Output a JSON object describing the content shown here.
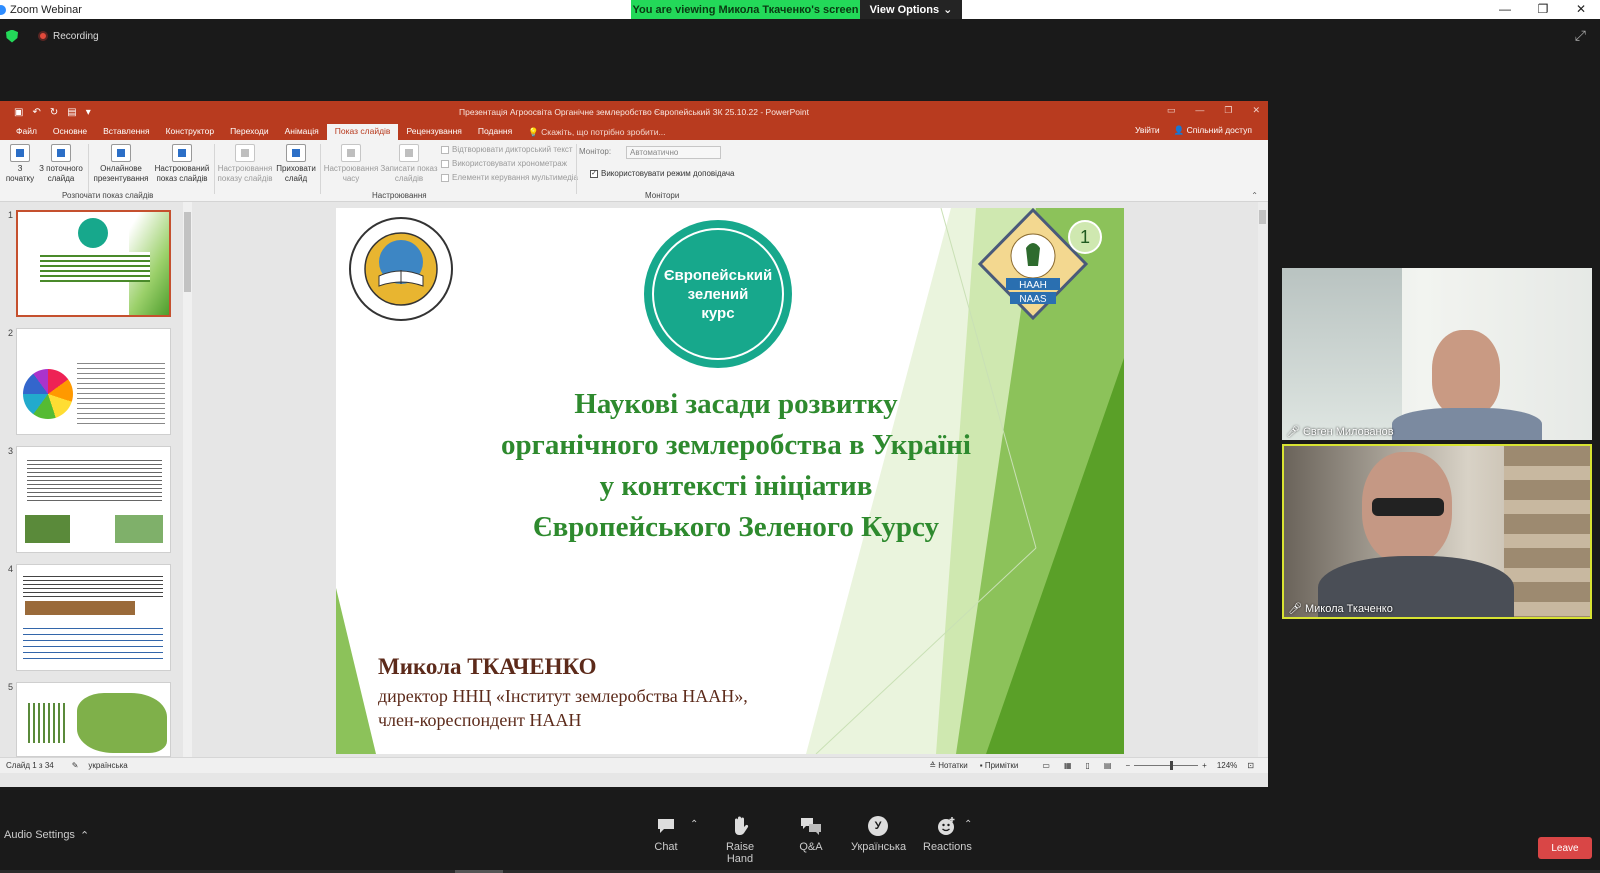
{
  "window": {
    "title": "Zoom Webinar",
    "viewing_banner": "You are viewing Микола Ткаченко's screen",
    "view_options": "View Options",
    "recording": "Recording"
  },
  "ppt": {
    "title": "Презентація Агроосвіта Органічне землеробство Європейський ЗК 25.10.22 - PowerPoint",
    "tabs": [
      "Файл",
      "Основне",
      "Вставлення",
      "Конструктор",
      "Переходи",
      "Анімація",
      "Показ слайдів",
      "Рецензування",
      "Подання"
    ],
    "tell_me": "Скажіть, що потрібно зробити...",
    "signin": "Увійти",
    "share": "Спільний доступ",
    "ribbon": {
      "from_begin": [
        "З",
        "початку"
      ],
      "from_current": [
        "З поточного",
        "слайда"
      ],
      "online": [
        "Онлайнове",
        "презентування"
      ],
      "custom": [
        "Настроюваний",
        "показ слайдів"
      ],
      "setup": [
        "Настроювання",
        "показу слайдів"
      ],
      "hide": [
        "Приховати",
        "слайд"
      ],
      "rehearse": [
        "Настроювання",
        "часу"
      ],
      "record": [
        "Записати показ",
        "слайдів"
      ],
      "play_narr": "Відтворювати дикторський текст",
      "use_timings": "Використовувати хронометраж",
      "show_media": "Елементи керування мультимедіа",
      "monitor_label": "Монітор:",
      "monitor_value": "Автоматично",
      "presenter_view": "Використовувати режим доповідача",
      "group_start": "Розпочати показ слайдів",
      "group_setup": "Настроювання",
      "group_monitors": "Монітори"
    },
    "status": {
      "slide_of": "Слайд 1 з 34",
      "lang": "українська",
      "notes": "Нотатки",
      "comments": "Примітки",
      "zoom": "124%"
    },
    "thumb_nums": [
      "1",
      "2",
      "3",
      "4",
      "5"
    ]
  },
  "slide": {
    "badge": [
      "Європейський",
      "зелений",
      "курс"
    ],
    "title": [
      "Наукові засади розвитку",
      "органічного землеробства в Україні",
      "у контексті ініціатив",
      "Європейського Зеленого Курсу"
    ],
    "author": "Микола ТКАЧЕНКО",
    "role1": "директор ННЦ «Інститут землеробства НААН»,",
    "role2": "член-кореспондент НААН",
    "page_no": "1",
    "naas_top": "НААН",
    "naas_bottom": "NAAS"
  },
  "participants": [
    {
      "name": "Євген Милованов"
    },
    {
      "name": "Микола Ткаченко"
    }
  ],
  "bottom": {
    "audio": "Audio Settings",
    "chat": "Chat",
    "raise": "Raise Hand",
    "qa": "Q&A",
    "lang": "Українська",
    "lang_letter": "У",
    "reactions": "Reactions",
    "leave": "Leave"
  },
  "colors": {
    "ppt_red": "#b83b1f",
    "slide_green": "#2e8a2e",
    "badge_teal": "#17a88c",
    "zoom_green": "#23d959"
  }
}
